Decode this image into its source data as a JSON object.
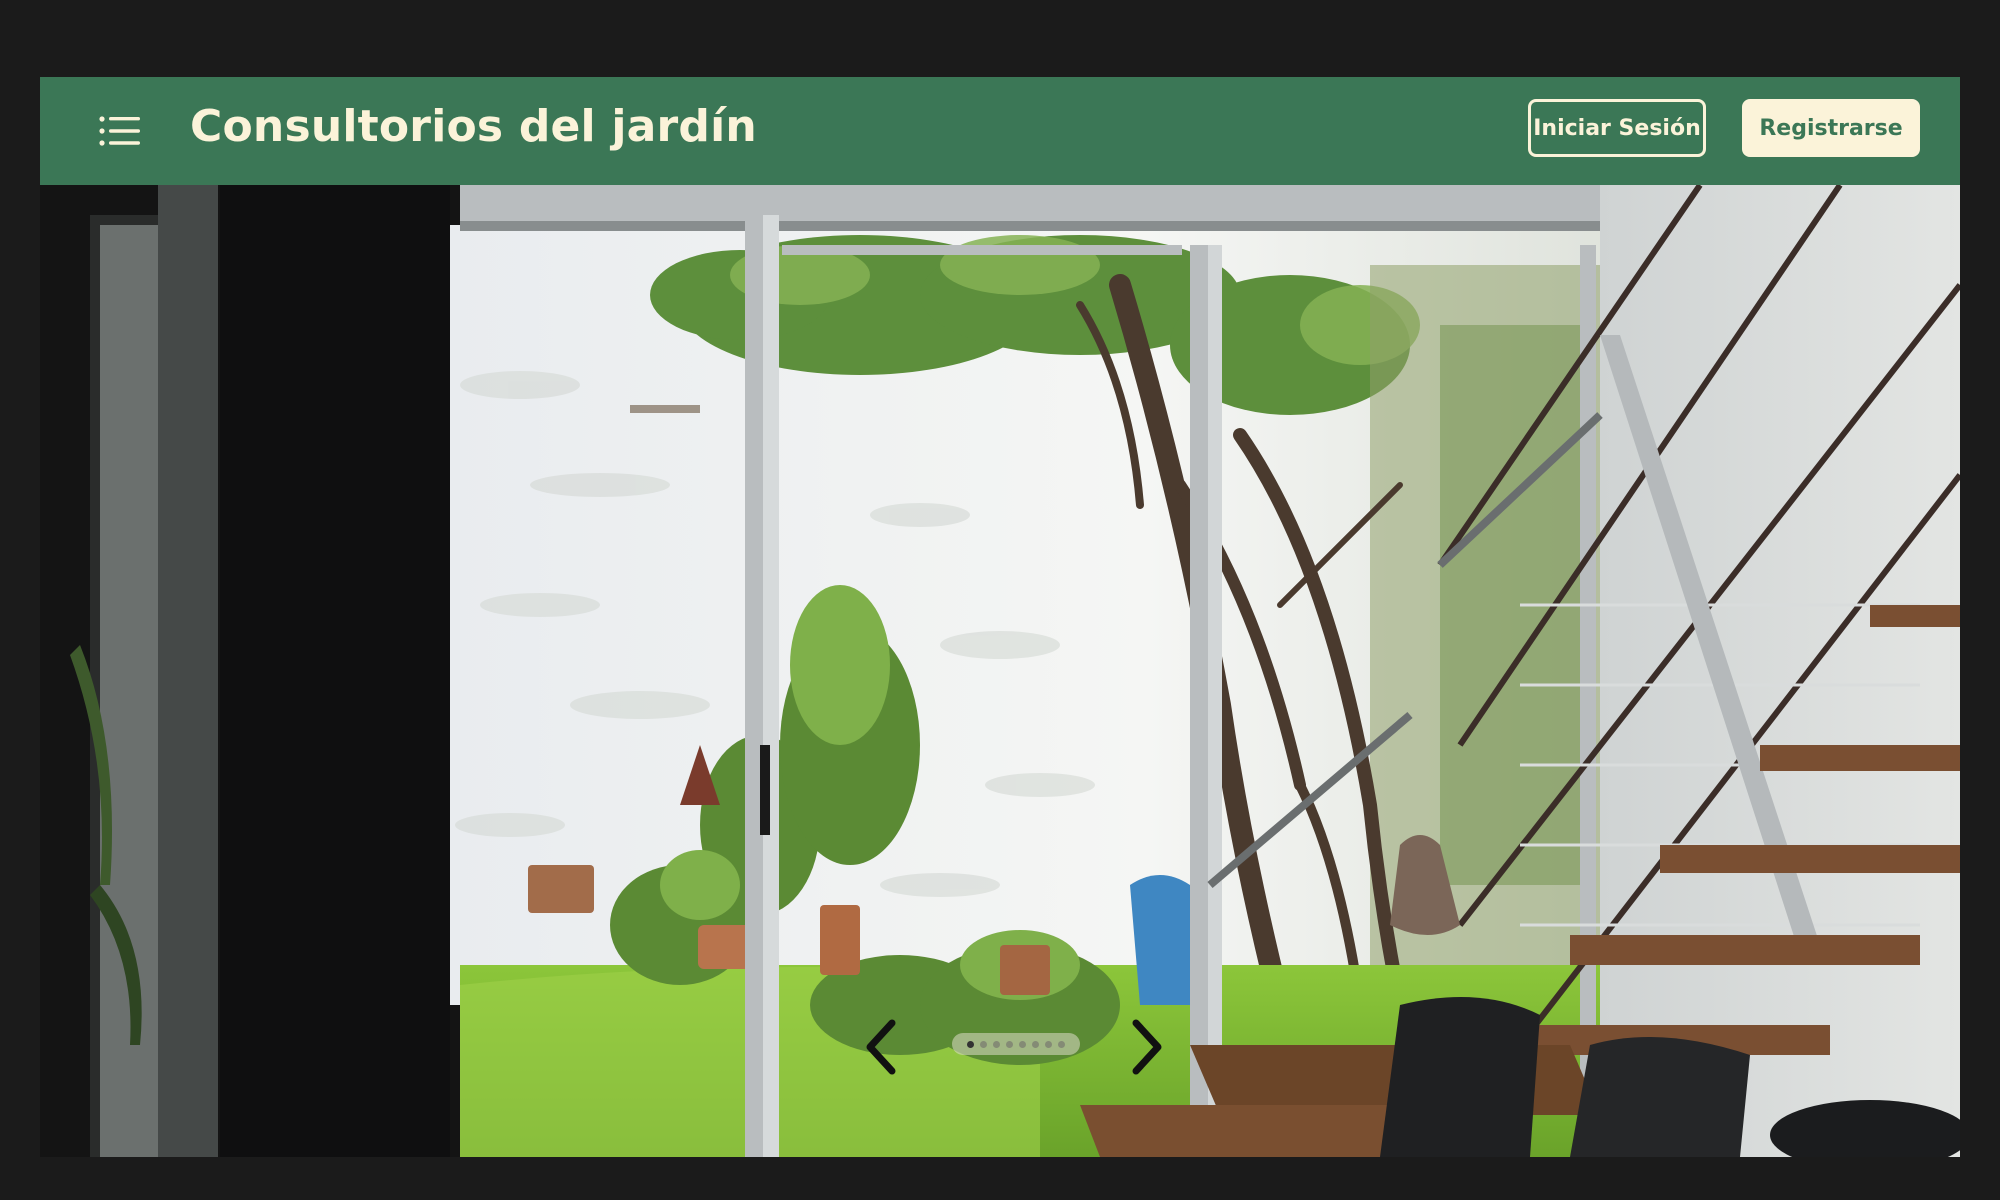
{
  "header": {
    "title": "Consultorios del jardín",
    "login_label": "Iniciar Sesión",
    "register_label": "Registrarse",
    "menu_icon": "list-menu-icon"
  },
  "carousel": {
    "slide_count": 8,
    "active_index": 0,
    "prev_icon": "chevron-left-icon",
    "next_icon": "chevron-right-icon"
  },
  "colors": {
    "header_bg": "#3b7756",
    "header_text": "#fbf3d9",
    "page_bg": "#1b1b1b"
  }
}
